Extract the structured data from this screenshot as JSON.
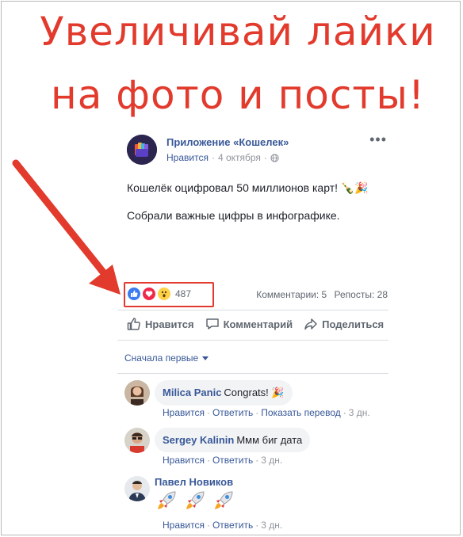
{
  "headline": {
    "line1": "Увеличивай лайки",
    "line2": "на фото и посты!"
  },
  "colors": {
    "accent_red": "#e23a2c",
    "link_blue": "#385898",
    "muted": "#90949c"
  },
  "post": {
    "author": "Приложение «Кошелек»",
    "likes_label": "Нравится",
    "date": "4 октября",
    "more_label": "•••",
    "text_line1": "Кошелёк оцифровал 50 миллионов карт! 🍾🎉",
    "text_line2": "Собрали важные цифры в инфографике.",
    "reactions_count": "487",
    "comments_stat": "Комментарии: 5",
    "reposts_stat": "Репосты: 28",
    "actions": {
      "like": "Нравится",
      "comment": "Комментарий",
      "share": "Поделиться"
    },
    "sort_label": "Сначала первые"
  },
  "comments": [
    {
      "name": "Milica Panic",
      "text": "Congrats! 🎉",
      "like": "Нравится",
      "reply": "Ответить",
      "translate": "Показать перевод",
      "time": "3 дн."
    },
    {
      "name": "Sergey Kalinin",
      "text": "Ммм биг дата",
      "like": "Нравится",
      "reply": "Ответить",
      "time": "3 дн."
    },
    {
      "name": "Павел Новиков",
      "text": "🚀🚀🚀",
      "like": "Нравится",
      "reply": "Ответить",
      "time": "3 дн."
    }
  ],
  "icons": [
    "app-logo-icon",
    "globe-icon",
    "like-reaction-icon",
    "love-reaction-icon",
    "wow-reaction-icon",
    "thumbs-up-icon",
    "comment-icon",
    "share-arrow-icon",
    "chevron-down-icon",
    "red-arrow-icon",
    "rocket-icon"
  ]
}
